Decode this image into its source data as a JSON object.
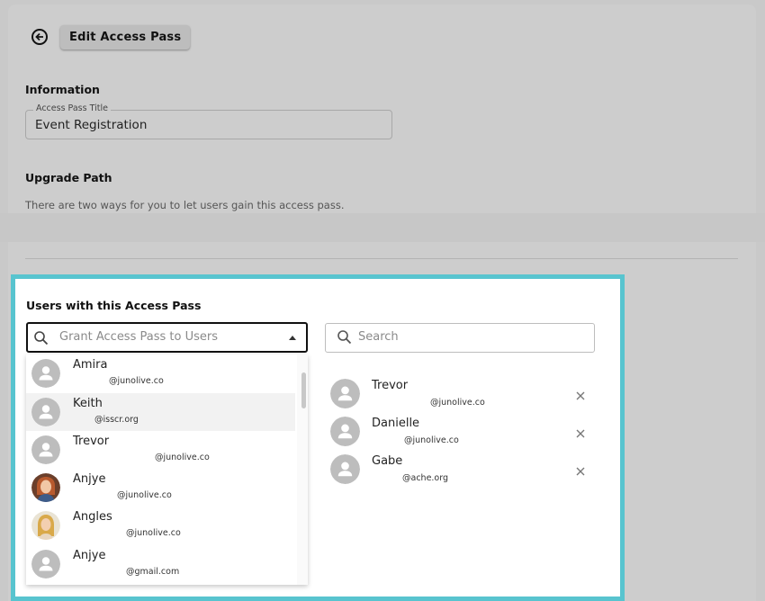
{
  "header": {
    "edit_label": "Edit Access Pass"
  },
  "information": {
    "heading": "Information",
    "title_label": "Access Pass Title",
    "title_value": "Event Registration"
  },
  "upgrade": {
    "heading": "Upgrade Path",
    "description": "There are two ways for you to let users gain this access pass."
  },
  "modal": {
    "title": "Users with this Access Pass",
    "grant_placeholder": "Grant Access Pass to Users",
    "search_placeholder": "Search",
    "options": [
      {
        "name": "Amira",
        "handle": "@junolive.co",
        "avatar": "default"
      },
      {
        "name": "Keith",
        "handle": "@isscr.org",
        "avatar": "default"
      },
      {
        "name": "Trevor",
        "handle": "@junolive.co",
        "avatar": "default"
      },
      {
        "name": "Anjye",
        "handle": "@junolive.co",
        "avatar": "photo-redhead"
      },
      {
        "name": "Angles",
        "handle": "@junolive.co",
        "avatar": "photo-blonde"
      },
      {
        "name": "Anjye",
        "handle": "@gmail.com",
        "avatar": "default"
      }
    ],
    "selected": [
      {
        "name": "Trevor",
        "handle": "@junolive.co"
      },
      {
        "name": "Danielle",
        "handle": "@junolive.co"
      },
      {
        "name": "Gabe",
        "handle": "@ache.org"
      }
    ]
  },
  "colors": {
    "modal_border": "#58c4cf",
    "backdrop": "#cdcdcd",
    "avatar_default": "#bdbdbd"
  }
}
